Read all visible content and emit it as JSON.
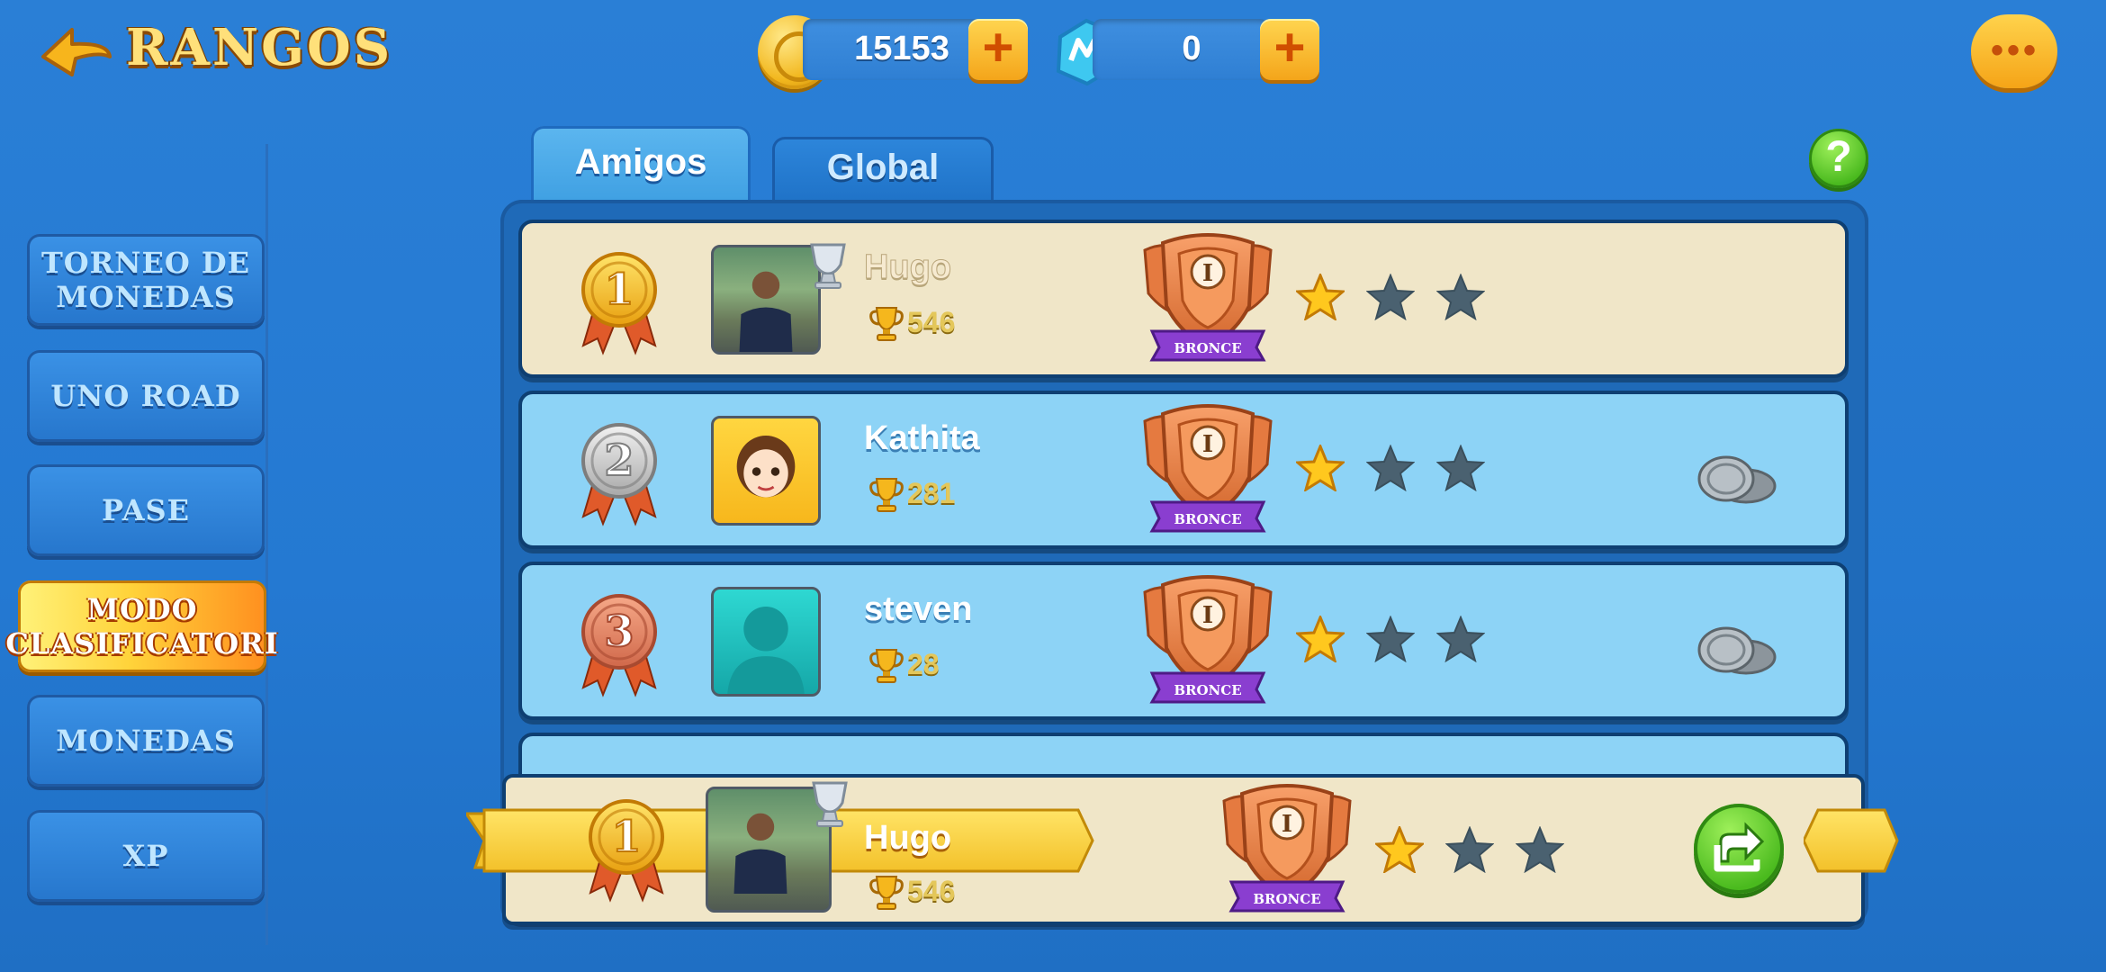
{
  "header": {
    "title": "RANGOS",
    "back_icon": "back-arrow-icon",
    "coins": {
      "icon": "coin-icon",
      "value": "15153"
    },
    "gems": {
      "icon": "gem-icon",
      "value": "0"
    },
    "plus_label": "+",
    "chat_icon": "chat-bubble-icon",
    "chat_dots": "•••"
  },
  "sidebar": {
    "items": [
      {
        "label": "TORNEO DE MONEDAS",
        "active": false
      },
      {
        "label": "UNO ROAD",
        "active": false
      },
      {
        "label": "PASE",
        "active": false
      },
      {
        "label": "MODO CLASIFICATORI",
        "active": true
      },
      {
        "label": "MONEDAS",
        "active": false
      },
      {
        "label": "XP",
        "active": false
      }
    ]
  },
  "tabs": [
    {
      "label": "Amigos",
      "active": true
    },
    {
      "label": "Global",
      "active": false
    }
  ],
  "help_label": "?",
  "leaderboard": [
    {
      "rank": "1",
      "name": "Hugo",
      "score": "546",
      "league": "BRONCE",
      "tier": "I",
      "stars_filled": 1,
      "stars_total": 3,
      "is_self": true
    },
    {
      "rank": "2",
      "name": "Kathita",
      "score": "281",
      "league": "BRONCE",
      "tier": "I",
      "stars_filled": 1,
      "stars_total": 3,
      "is_self": false
    },
    {
      "rank": "3",
      "name": "steven",
      "score": "28",
      "league": "BRONCE",
      "tier": "I",
      "stars_filled": 1,
      "stars_total": 3,
      "is_self": false
    }
  ],
  "self": {
    "rank": "1",
    "name": "Hugo",
    "score": "546",
    "league": "BRONCE",
    "tier": "I",
    "stars_filled": 1,
    "stars_total": 3,
    "share_icon": "share-icon"
  },
  "colors": {
    "background": "#2479d2",
    "row_self": "#f0e6c8",
    "row_friend": "#8dd3f6",
    "gold": "#f5b71d",
    "bronze": "#e07a3a",
    "league_ribbon": "#8a3ed0"
  }
}
